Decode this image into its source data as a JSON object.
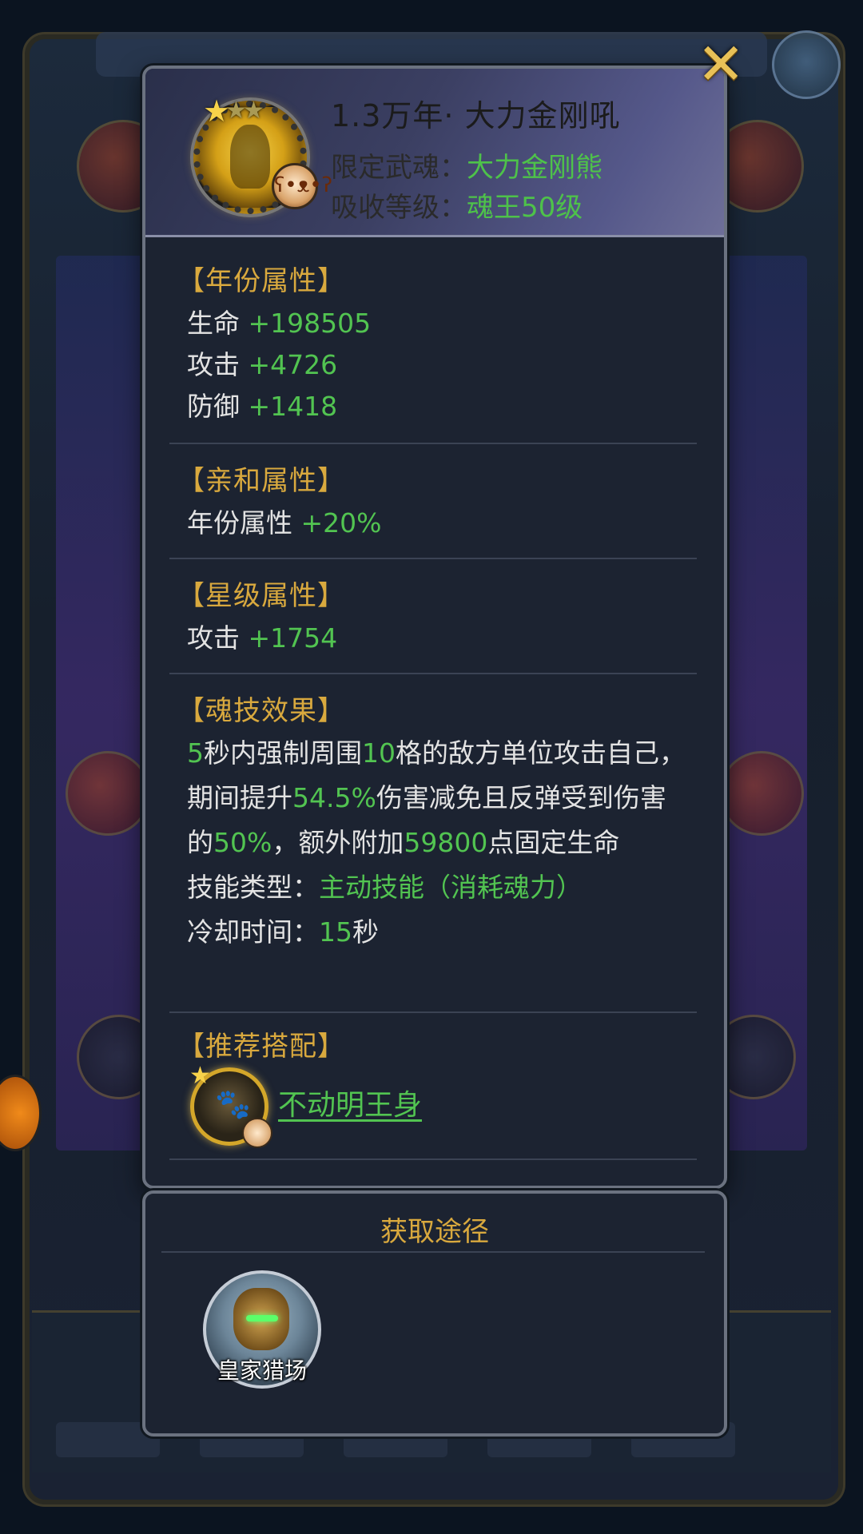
{
  "header": {
    "title": "1.3万年·  大力金刚吼",
    "limit_label": "限定武魂：",
    "limit_value": "大力金刚熊",
    "absorb_label": "吸收等级：",
    "absorb_value": "魂王50级",
    "stars": 3
  },
  "sections": {
    "year": {
      "heading": "【年份属性】",
      "rows": [
        {
          "label": "生命",
          "value": "+198505"
        },
        {
          "label": "攻击",
          "value": "+4726"
        },
        {
          "label": "防御",
          "value": "+1418"
        }
      ]
    },
    "affinity": {
      "heading": "【亲和属性】",
      "rows": [
        {
          "label": "年份属性",
          "value": "+20%"
        }
      ]
    },
    "star": {
      "heading": "【星级属性】",
      "rows": [
        {
          "label": "攻击",
          "value": "+1754"
        }
      ]
    },
    "skill": {
      "heading": "【魂技效果】",
      "desc_parts": [
        {
          "t": "5",
          "g": true
        },
        {
          "t": "秒内强制周围",
          "g": false
        },
        {
          "t": "10",
          "g": true
        },
        {
          "t": "格的敌方单位攻击自己，期间提升",
          "g": false
        },
        {
          "t": "54.5%",
          "g": true
        },
        {
          "t": "伤害减免且反弹受到伤害的",
          "g": false
        },
        {
          "t": "50%",
          "g": true
        },
        {
          "t": "，额外附加",
          "g": false
        },
        {
          "t": "59800",
          "g": true
        },
        {
          "t": "点固定生命",
          "g": false
        }
      ],
      "type_label": "技能类型：",
      "type_value": "主动技能（消耗魂力）",
      "cd_label": "冷却时间：",
      "cd_value": "15",
      "cd_unit": "秒"
    },
    "recommend": {
      "heading": "【推荐搭配】",
      "item_name": "不动明王身"
    }
  },
  "source": {
    "title": "获取途径",
    "items": [
      {
        "label": "皇家猎场",
        "icon": "royal-hunting-ground-icon"
      }
    ]
  },
  "close_icon": "close-icon",
  "colors": {
    "accent_gold": "#d9a93e",
    "value_green": "#52c451",
    "panel_bg": "#1c2331"
  }
}
